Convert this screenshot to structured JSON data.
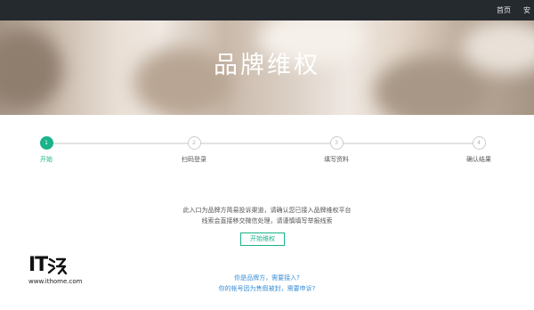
{
  "nav": {
    "items": [
      "首页",
      "安"
    ]
  },
  "banner": {
    "title": "品牌维权"
  },
  "steps": [
    {
      "number": "1",
      "label": "开始"
    },
    {
      "number": "2",
      "label": "扫码登录"
    },
    {
      "number": "3",
      "label": "填写资料"
    },
    {
      "number": "4",
      "label": "确认结果"
    }
  ],
  "active_step": 1,
  "content": {
    "line1": "此入口为品牌方简易投诉渠道，请确认您已接入品牌维权平台",
    "line2": "线索会直接移交微信处理，请谨慎填写举报线索",
    "start_button": "开始维权",
    "link_brand": "你是品牌方，需要接入?",
    "link_account": "你的帐号因为售假被封，需要申诉?"
  },
  "watermark": {
    "url": "www.ithome.com",
    "brand_text": "IT之家"
  },
  "colors": {
    "accent": "#1ab38a",
    "link": "#3b8fd6",
    "topbar": "#252a2f"
  }
}
